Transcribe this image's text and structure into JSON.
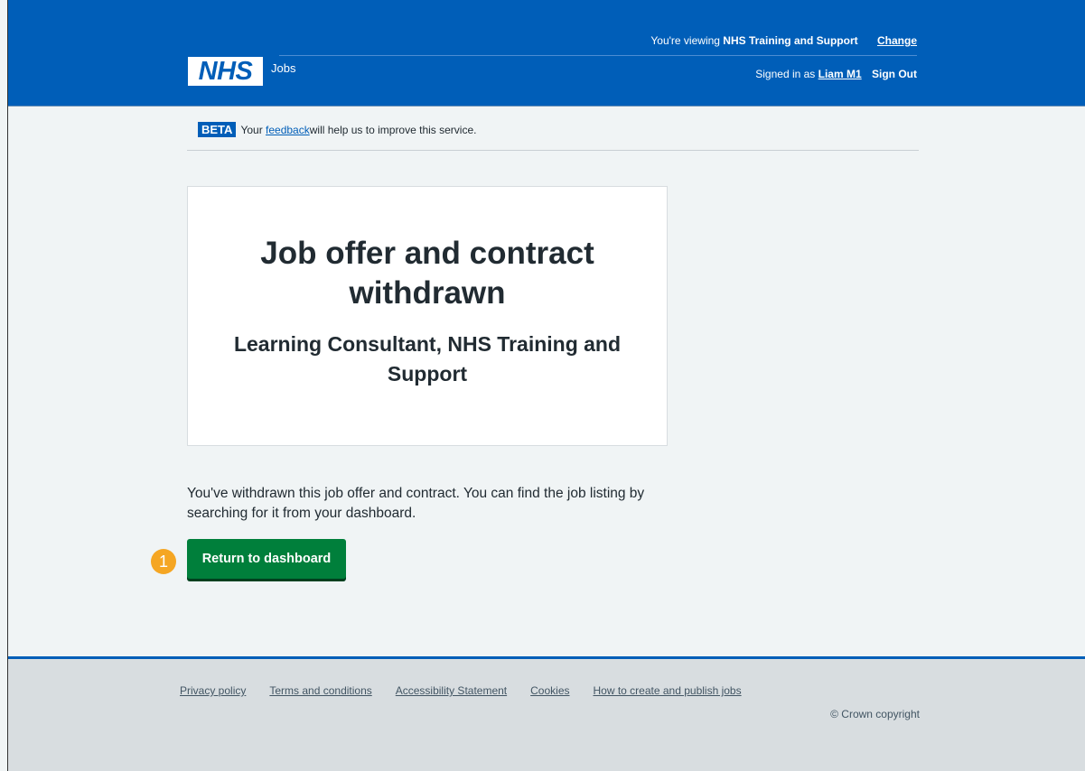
{
  "header": {
    "viewing_prefix": "You're viewing ",
    "organisation": "NHS Training and Support",
    "change_label": "Change",
    "logo_text": "NHS",
    "service_name": "Jobs",
    "signed_in_prefix": "Signed in as ",
    "user_name": "Liam M1",
    "sign_out_label": "Sign Out",
    "brand_color": "#005eb8"
  },
  "beta_banner": {
    "tag": "BETA",
    "prefix": "Your ",
    "link_text": "feedback",
    "suffix": " will help us to improve this service."
  },
  "panel": {
    "title": "Job offer and contract withdrawn",
    "subtitle": "Learning Consultant, NHS Training and Support"
  },
  "main": {
    "body_text": "You've withdrawn this job offer and contract. You can find the job listing by searching for it from your dashboard.",
    "step_number": "1",
    "primary_button_label": "Return to dashboard",
    "button_color": "#007f3b",
    "badge_color": "#f5a623"
  },
  "footer": {
    "links": [
      "Privacy policy",
      "Terms and conditions",
      "Accessibility Statement",
      "Cookies",
      "How to create and publish jobs"
    ],
    "copyright": "© Crown copyright"
  }
}
